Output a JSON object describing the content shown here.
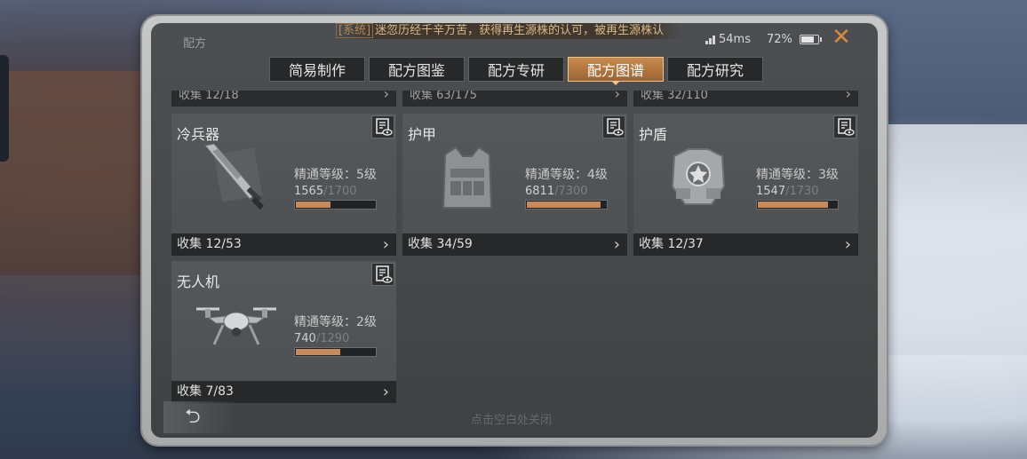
{
  "window": {
    "title": "配方"
  },
  "marquee": {
    "tag": "[系统]",
    "text": "迷忽历经千辛万苦，获得再生源株的认可，被再生源株认"
  },
  "status": {
    "ping": "54ms",
    "battery": "72%"
  },
  "tabs": [
    {
      "label": "简易制作"
    },
    {
      "label": "配方图鉴"
    },
    {
      "label": "配方专研"
    },
    {
      "label": "配方图谱",
      "active": true
    },
    {
      "label": "配方研究"
    }
  ],
  "partial_row": [
    {
      "collect": "收集 12/18"
    },
    {
      "collect": "收集 63/175"
    },
    {
      "collect": "收集 32/110"
    }
  ],
  "cards": [
    {
      "name": "冷兵器",
      "level": "精通等级：5级",
      "progress": "1565",
      "max": "/1700",
      "fill": 0.45,
      "collect": "收集 12/53",
      "icon": "sword-icon"
    },
    {
      "name": "护甲",
      "level": "精通等级：4级",
      "progress": "6811",
      "max": "/7300",
      "fill": 0.93,
      "collect": "收集 34/59",
      "icon": "vest-icon"
    },
    {
      "name": "护盾",
      "level": "精通等级：3级",
      "progress": "1547",
      "max": "/1730",
      "fill": 0.89,
      "collect": "收集 12/37",
      "icon": "shield-armor-icon"
    },
    {
      "name": "无人机",
      "level": "精通等级：2级",
      "progress": "740",
      "max": "/1290",
      "fill": 0.57,
      "collect": "收集 7/83",
      "icon": "drone-icon"
    }
  ],
  "bottom_hint": "点击空白处关闭",
  "back": {
    "icon": "undo-arrow-icon",
    "glyph": "⮌"
  },
  "colors": {
    "accent": "#c88a4c",
    "close": "#d88a3a",
    "bar_fill": "#c88a58"
  }
}
